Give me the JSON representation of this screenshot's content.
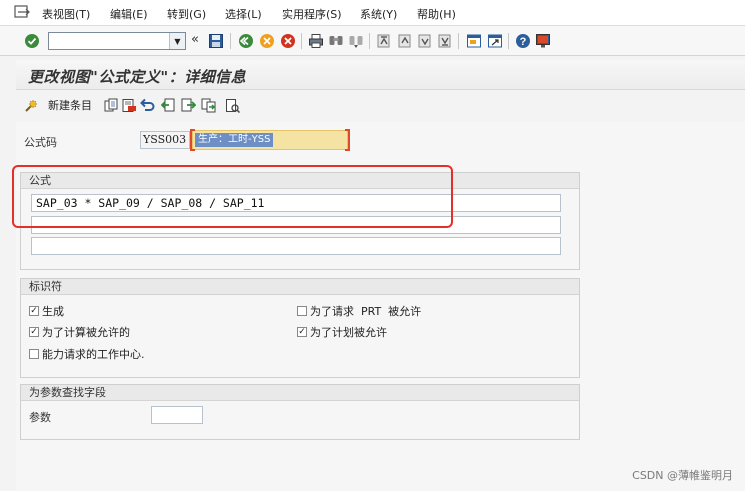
{
  "menubar": {
    "items": [
      "表视图(T)",
      "编辑(E)",
      "转到(G)",
      "选择(L)",
      "实用程序(S)",
      "系统(Y)",
      "帮助(H)"
    ]
  },
  "toolbar": {
    "command_value": "",
    "nav_symbol": "«"
  },
  "title": "更改视图\"公式定义\"：详细信息",
  "app_toolbar": {
    "new_entry_label": "新建条目"
  },
  "formula_code": {
    "label": "公式码",
    "value": "YSS003",
    "description": "生产：工时-YSS"
  },
  "formula_group": {
    "title": "公式",
    "lines": [
      "SAP_03 * SAP_09 / SAP_08 / SAP_11",
      "",
      ""
    ]
  },
  "indicator_group": {
    "title": "标识符",
    "checkboxes": [
      {
        "label": "生成",
        "checked": "✓"
      },
      {
        "label": "为了请求  PRT  被允许",
        "checked": ""
      },
      {
        "label": "为了计算被允许的",
        "checked": "✓"
      },
      {
        "label": "为了计划被允许",
        "checked": "✓"
      },
      {
        "label": "能力请求的工作中心.",
        "checked": ""
      }
    ]
  },
  "param_group": {
    "title": "为参数查找字段",
    "param_label": "参数",
    "param_value": ""
  },
  "watermark": "CSDN @薄帷鉴明月",
  "colors": {
    "highlight": "#e5302a",
    "selected_field": "#f5e3a3",
    "selection": "#6d8fc6"
  }
}
